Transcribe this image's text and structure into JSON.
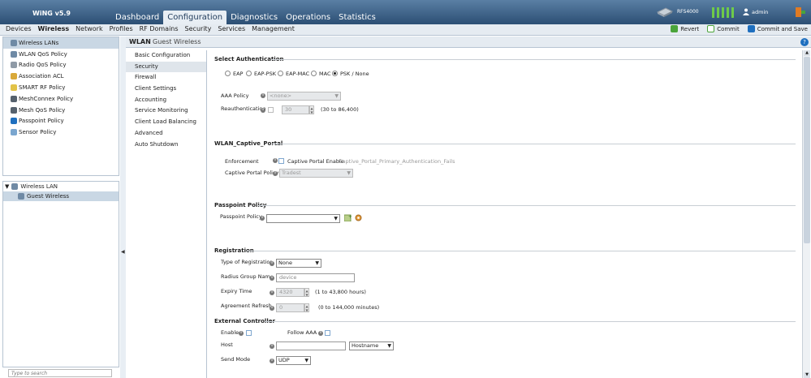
{
  "app": {
    "name": "WiNG v5.9",
    "device": "RFS4000",
    "user": "admin"
  },
  "topnav": [
    {
      "label": "Dashboard"
    },
    {
      "label": "Configuration"
    },
    {
      "label": "Diagnostics"
    },
    {
      "label": "Operations"
    },
    {
      "label": "Statistics"
    }
  ],
  "subnav": [
    {
      "label": "Devices"
    },
    {
      "label": "Wireless"
    },
    {
      "label": "Network"
    },
    {
      "label": "Profiles"
    },
    {
      "label": "RF Domains"
    },
    {
      "label": "Security"
    },
    {
      "label": "Services"
    },
    {
      "label": "Management"
    }
  ],
  "actions": {
    "revert": "Revert",
    "commit": "Commit",
    "commit_save": "Commit and Save"
  },
  "left_menu": [
    {
      "label": "Wireless LANs"
    },
    {
      "label": "WLAN QoS Policy"
    },
    {
      "label": "Radio QoS Policy"
    },
    {
      "label": "Association ACL"
    },
    {
      "label": "SMART RF Policy"
    },
    {
      "label": "MeshConnex Policy"
    },
    {
      "label": "Mesh QoS Policy"
    },
    {
      "label": "Passpoint Policy"
    },
    {
      "label": "Sensor Policy"
    }
  ],
  "tree": {
    "root": "Wireless LAN",
    "child": "Guest Wireless"
  },
  "search": {
    "placeholder": "Type to search"
  },
  "header": {
    "prefix": "WLAN",
    "name": "Guest Wireless",
    "help": "?"
  },
  "config_menu": [
    {
      "label": "Basic Configuration"
    },
    {
      "label": "Security"
    },
    {
      "label": "Firewall"
    },
    {
      "label": "Client Settings"
    },
    {
      "label": "Accounting"
    },
    {
      "label": "Service Monitoring"
    },
    {
      "label": "Client Load Balancing"
    },
    {
      "label": "Advanced"
    },
    {
      "label": "Auto Shutdown"
    }
  ],
  "security": {
    "select_auth_title": "Select Authentication",
    "auth_options": [
      {
        "label": "EAP",
        "selected": false
      },
      {
        "label": "EAP-PSK",
        "selected": false
      },
      {
        "label": "EAP-MAC",
        "selected": false
      },
      {
        "label": "MAC",
        "selected": false
      },
      {
        "label": "PSK / None",
        "selected": true
      }
    ],
    "aaa_policy_label": "AAA Policy",
    "aaa_policy_value": "<none>",
    "reauth_label": "Reauthentication",
    "reauth_value": "30",
    "reauth_range": "(30 to 86,400)",
    "captive_title": "WLAN_Captive_Portal",
    "enforcement_label": "Enforcement",
    "captive_enable_label": "Captive Portal Enable",
    "captive_fail_text": "Captive_Portal_Primary_Authentication_Fails",
    "captive_policy_label": "Captive Portal Policy",
    "captive_policy_value": "Tradest",
    "passpoint_title": "Passpoint Policy",
    "passpoint_label": "Passpoint Policy",
    "passpoint_value": "",
    "registration_title": "Registration",
    "reg_type_label": "Type of Registration",
    "reg_type_value": "None",
    "radius_group_label": "Radius Group Name",
    "radius_group_placeholder": "device",
    "expiry_label": "Expiry Time",
    "expiry_value": "4320",
    "expiry_range": "(1 to 43,800 hours)",
    "agreement_label": "Agreement Refresh",
    "agreement_value": "0",
    "agreement_range": "(0 to 144,000 minutes)",
    "ext_ctrl_title": "External Controller",
    "enable_label": "Enable",
    "follow_aaa_label": "Follow AAA",
    "host_label": "Host",
    "host_value": "",
    "host_type_value": "Hostname",
    "send_mode_label": "Send Mode",
    "send_mode_value": "UDP"
  },
  "colors": {
    "header_bg": "#2c4f74",
    "accent": "#1e6fbf",
    "selected_row": "#c9d7e4",
    "signal_bars": "#6ecb4a"
  }
}
